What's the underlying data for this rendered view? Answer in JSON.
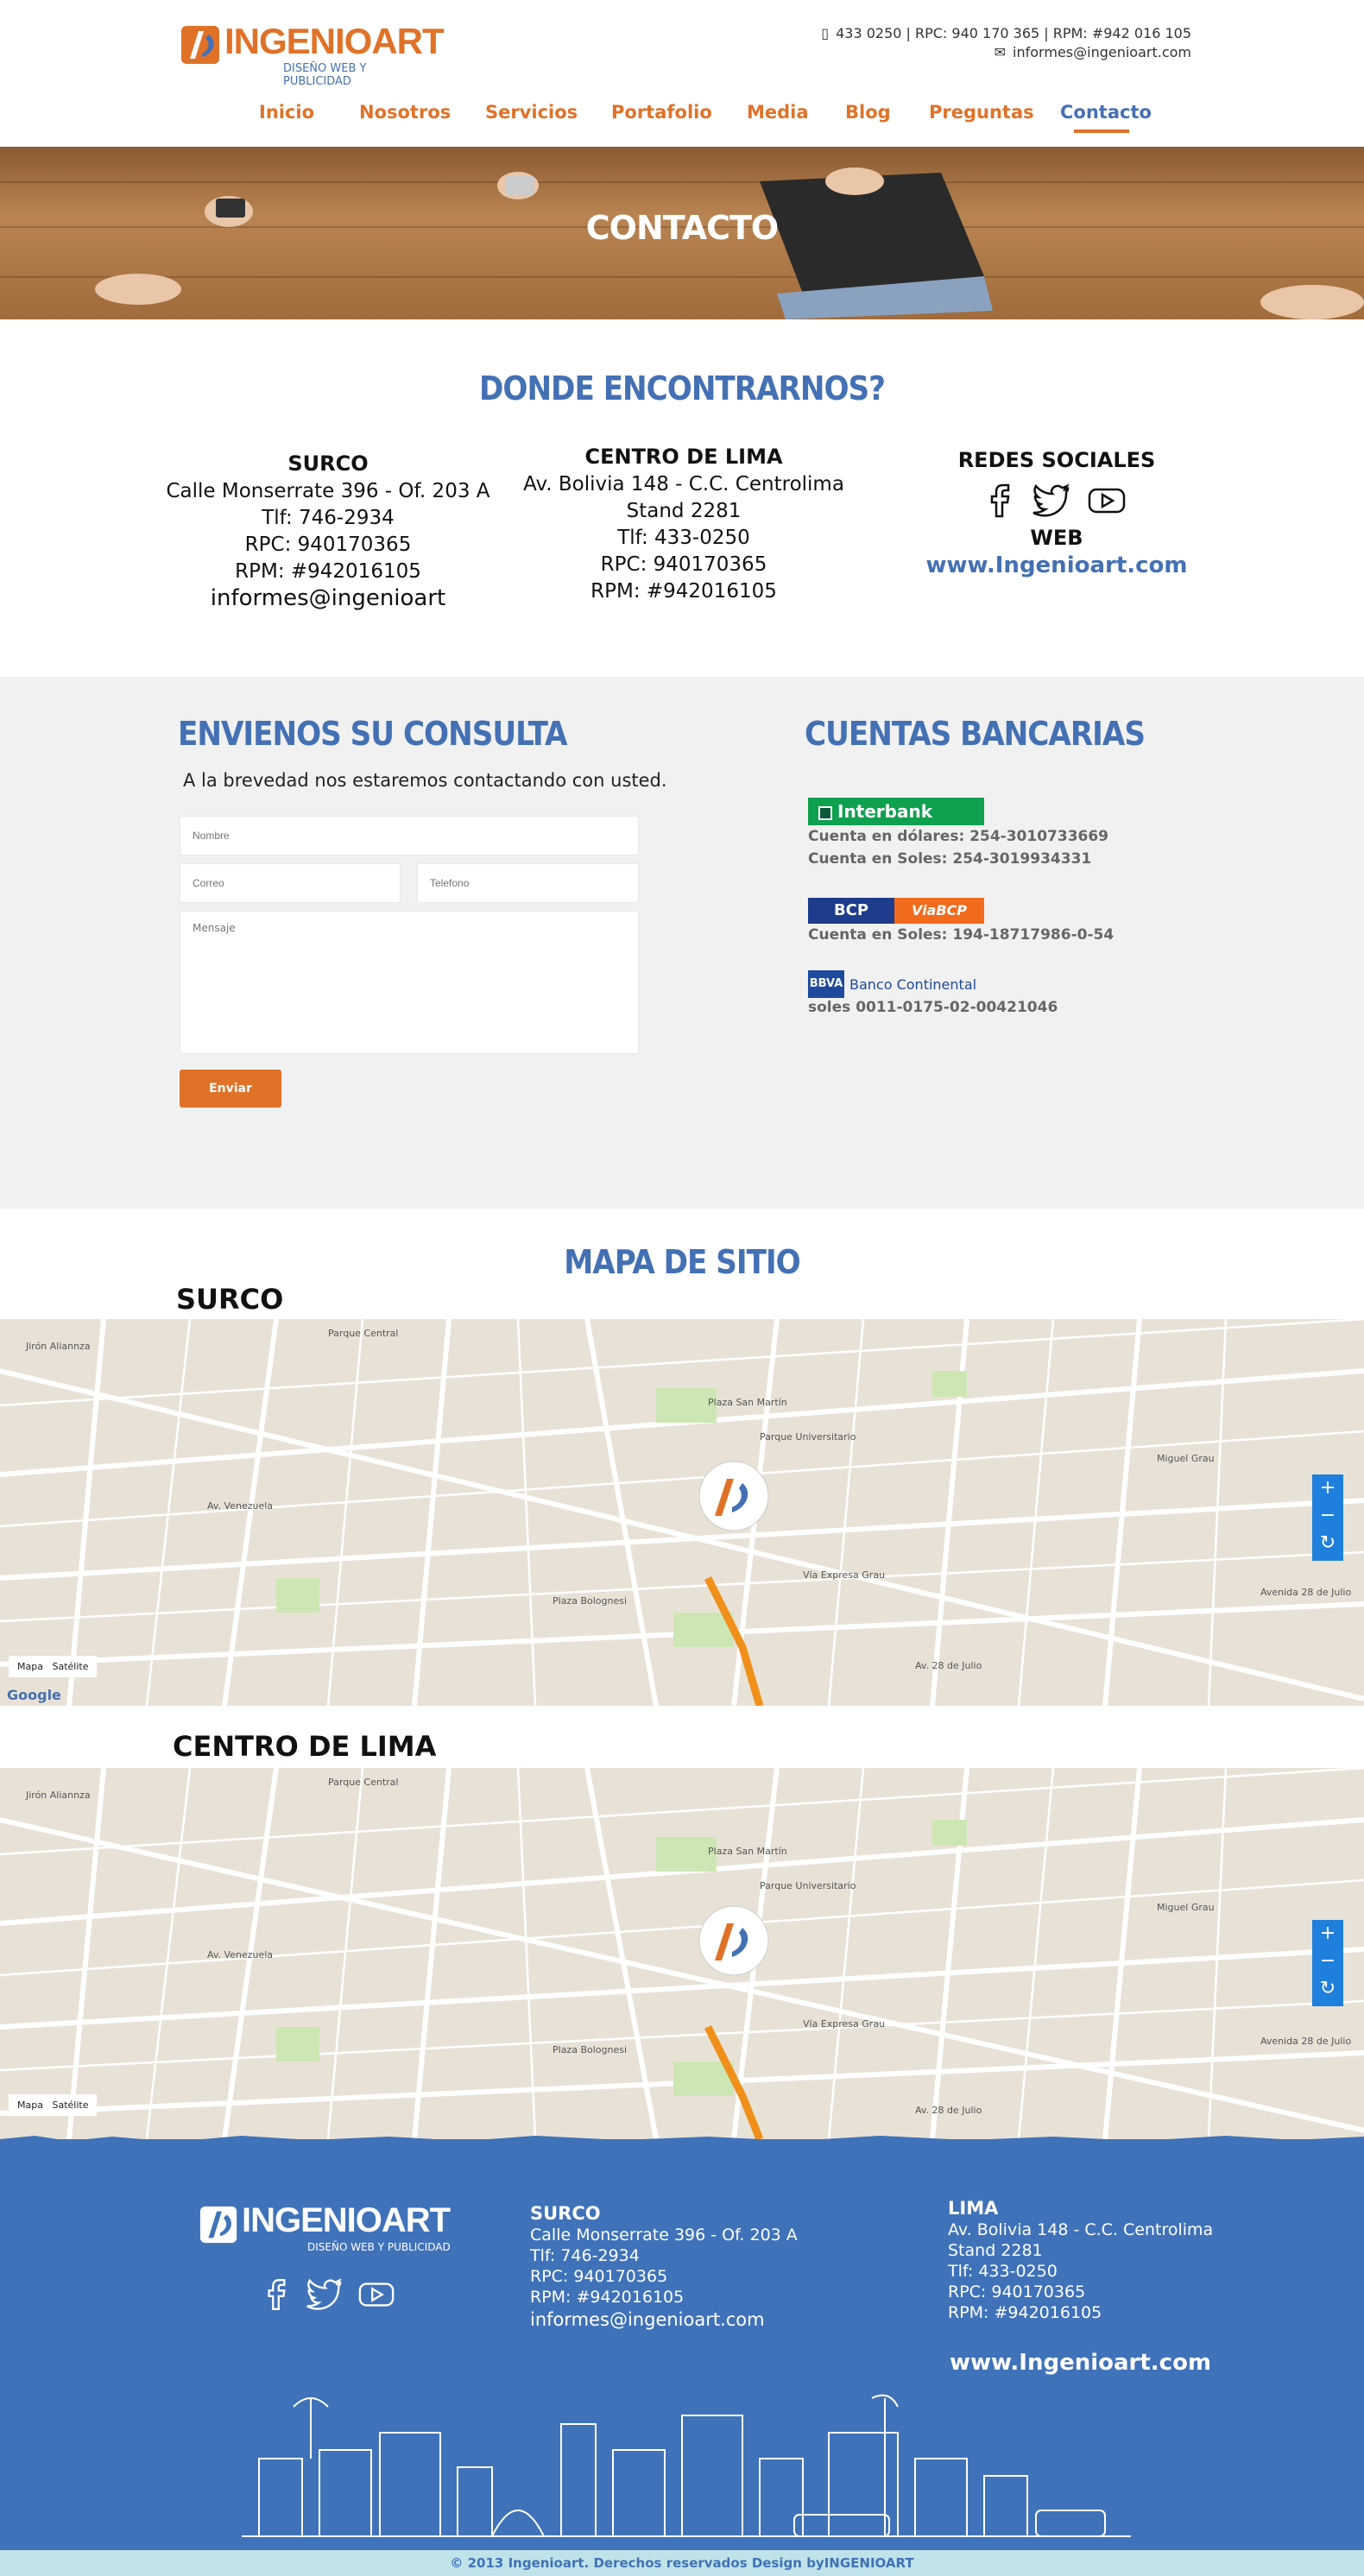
{
  "brand": {
    "name": "INGENIOART",
    "tagline": "DISEÑO WEB Y PUBLICIDAD",
    "accent": "#e07228",
    "blue": "#4470b4"
  },
  "top_contact": {
    "phones": "433 0250 | RPC: 940 170 365 | RPM: #942 016 105",
    "email": "informes@ingenioart.com"
  },
  "nav": [
    {
      "label": "Inicio"
    },
    {
      "label": "Nosotros"
    },
    {
      "label": "Servicios"
    },
    {
      "label": "Portafolio"
    },
    {
      "label": "Media"
    },
    {
      "label": "Blog"
    },
    {
      "label": "Preguntas"
    },
    {
      "label": "Contacto"
    }
  ],
  "hero": {
    "title": "CONTACTO"
  },
  "locate": {
    "title": "DONDE ENCONTRARNOS?",
    "surco": {
      "name": "SURCO",
      "l1": "Calle Monserrate 396 - Of. 203 A",
      "l2": "Tlf: 746-2934",
      "l3": "RPC: 940170365",
      "l4": "RPM: #942016105",
      "l5": "informes@ingenioart"
    },
    "lima": {
      "name": "CENTRO DE LIMA",
      "l1": "Av. Bolivia 148 - C.C. Centrolima",
      "l2": "Stand 2281",
      "l3": "Tlf: 433-0250",
      "l4": "RPC: 940170365",
      "l5": "RPM: #942016105"
    },
    "social": {
      "title": "REDES SOCIALES",
      "web_title": "WEB",
      "web": "www.Ingenioart.com"
    }
  },
  "form": {
    "title": "ENVIENOS SU CONSULTA",
    "subtitle": "A la brevedad nos estaremos contactando con usted.",
    "name_ph": "Nombre",
    "email_ph": "Correo",
    "phone_ph": "Telefono",
    "msg_ph": "Mensaje",
    "submit": "Enviar"
  },
  "banks": {
    "title": "CUENTAS BANCARIAS",
    "interbank": {
      "logo": "Interbank",
      "l1": "Cuenta en dólares: 254-3010733669",
      "l2": "Cuenta en Soles: 254-3019934331"
    },
    "bcp": {
      "logo": "BCP",
      "logo2": "ViaBCP",
      "l1": "Cuenta en Soles: 194-18717986-0-54"
    },
    "bbva": {
      "logo": "BBVA",
      "logo2": "Banco Continental",
      "l1": "soles 0011-0175-02-00421046"
    }
  },
  "sitemap": {
    "title": "MAPA DE SITIO",
    "map1": "SURCO",
    "map2": "CENTRO DE LIMA",
    "mapa": "Mapa",
    "satelite": "Satélite",
    "google": "Google"
  },
  "footer": {
    "surco": {
      "name": "SURCO",
      "l1": "Calle Monserrate 396 - Of. 203 A",
      "l2": "Tlf: 746-2934",
      "l3": "RPC: 940170365",
      "l4": "RPM: #942016105",
      "l5": "informes@ingenioart.com"
    },
    "lima": {
      "name": "LIMA",
      "l1": "Av. Bolivia 148 - C.C. Centrolima",
      "l2": "Stand 2281",
      "l3": "Tlf: 433-0250",
      "l4": "RPC: 940170365",
      "l5": "RPM: #942016105"
    },
    "web": "www.Ingenioart.com",
    "copyright": "© 2013 Ingenioart. Derechos reservados Design byINGENIOART"
  }
}
